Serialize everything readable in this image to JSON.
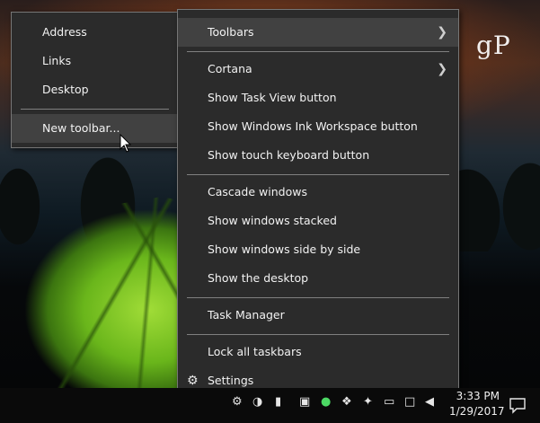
{
  "watermark": "gP",
  "context_menu": {
    "items": [
      {
        "label": "Toolbars",
        "submenu": true,
        "highlighted": true
      },
      {
        "label": "Cortana",
        "submenu": true
      },
      {
        "label": "Show Task View button"
      },
      {
        "label": "Show Windows Ink Workspace button"
      },
      {
        "label": "Show touch keyboard button"
      },
      {
        "label": "Cascade windows"
      },
      {
        "label": "Show windows stacked"
      },
      {
        "label": "Show windows side by side"
      },
      {
        "label": "Show the desktop"
      },
      {
        "label": "Task Manager"
      },
      {
        "label": "Lock all taskbars"
      },
      {
        "label": "Settings",
        "icon": "gear-icon"
      }
    ]
  },
  "toolbars_submenu": {
    "items": [
      {
        "label": "Address"
      },
      {
        "label": "Links"
      },
      {
        "label": "Desktop"
      },
      {
        "label": "New toolbar...",
        "highlighted": true
      }
    ]
  },
  "taskbar": {
    "clock_time": "3:33 PM",
    "clock_date": "1/29/2017",
    "tray_icons": [
      "settings-icon",
      "shield-icon",
      "battery-icon",
      "app-icon",
      "messenger-icon",
      "dropbox-icon",
      "bluetooth-icon",
      "usb-icon",
      "network-icon",
      "volume-icon",
      "action-center-icon"
    ]
  }
}
